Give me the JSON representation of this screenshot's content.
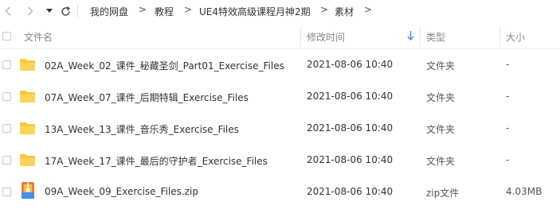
{
  "breadcrumb": {
    "items": [
      "我的网盘",
      "教程",
      "UE4特效高级课程月神2期",
      "素材"
    ],
    "separator": ">"
  },
  "columns": {
    "name": "文件名",
    "modified": "修改时间",
    "type": "类型",
    "size": "大小"
  },
  "files": [
    {
      "name": "02A_Week_02_课件_秘藏圣剑_Part01_Exercise_Files",
      "modified": "2021-08-06 10:40",
      "type": "文件夹",
      "size": "-",
      "icon": "folder-icon"
    },
    {
      "name": "07A_Week_07_课件_后期特辑_Exercise_Files",
      "modified": "2021-08-06 10:40",
      "type": "文件夹",
      "size": "-",
      "icon": "folder-icon"
    },
    {
      "name": "13A_Week_13_课件_音乐秀_Exercise_Files",
      "modified": "2021-08-06 10:40",
      "type": "文件夹",
      "size": "-",
      "icon": "folder-icon"
    },
    {
      "name": "17A_Week_17_课件_最后的守护者_Exercise_Files",
      "modified": "2021-08-06 10:40",
      "type": "文件夹",
      "size": "-",
      "icon": "folder-icon"
    },
    {
      "name": "09A_Week_09_Exercise_Files.zip",
      "modified": "2021-08-06 10:40",
      "type": "zip文件",
      "size": "4.03MB",
      "icon": "zip-file-icon"
    }
  ],
  "colors": {
    "folder": "#f9c83a",
    "sort_arrow": "#3b8beb",
    "zip_orange": "#f07a3a",
    "zip_blue": "#4a8df0"
  }
}
